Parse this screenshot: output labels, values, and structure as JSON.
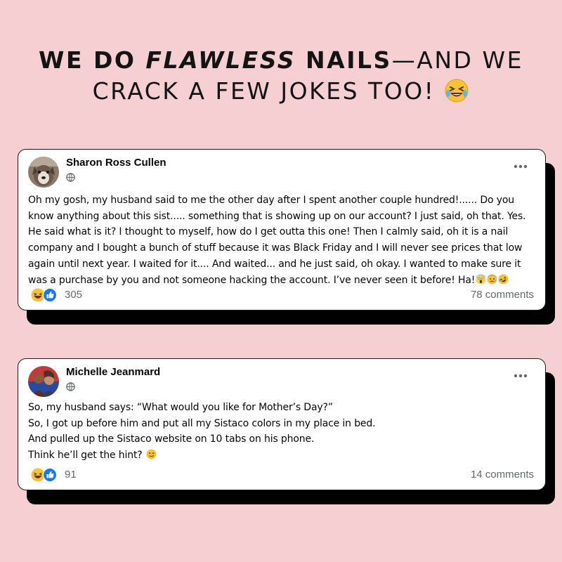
{
  "headline": {
    "line1_pre": "WE DO ",
    "line1_em": "FLAWLESS",
    "line1_bold": " NAILS",
    "line1_post": "—AND WE",
    "line2": "CRACK A FEW JOKES TOO! ",
    "emoji": "rofl-emoji"
  },
  "colors": {
    "background": "#f5cfd2",
    "card": "#ffffff",
    "shadow": "#000000",
    "meta_text": "#65676b",
    "like_blue": "#1877f2",
    "haha_yellow": "#f7c23a"
  },
  "posts": [
    {
      "author": "Sharon Ross Cullen",
      "privacy_icon": "globe-icon",
      "lines": [
        "Oh my gosh, my husband said to me the other day after I spent another couple hundred!......  Do you",
        "know anything about this sist..... something that is showing up on our account? I just said, oh that. Yes.",
        "He said what is it? I thought to myself, how do I get outta this one! Then I calmly said, oh it is a nail",
        "company and I bought a bunch of stuff because it was Black Friday and I will never see prices that low",
        "again until next year. I waited for it.... And waited... and he just said, oh okay. I wanted to make sure it",
        "was a purchase by you and not someone hacking the account. I’ve never seen it before! Ha!"
      ],
      "trailing_emojis": [
        "scream-emoji",
        "anxious-emoji",
        "rofl-emoji"
      ],
      "reaction_count": "305",
      "comments": "78 comments"
    },
    {
      "author": "Michelle Jeanmard",
      "privacy_icon": "globe-icon",
      "lines": [
        "So, my husband says: “What would you like for Mother’s Day?”",
        "So, I got up before him and put all my Sistaco colors in my place in bed.",
        "And pulled up the Sistaco website on 10 tabs on his phone.",
        "Think he’ll get the hint?"
      ],
      "trailing_emojis": [
        "wink-emoji"
      ],
      "reaction_count": "91",
      "comments": "14 comments"
    }
  ]
}
